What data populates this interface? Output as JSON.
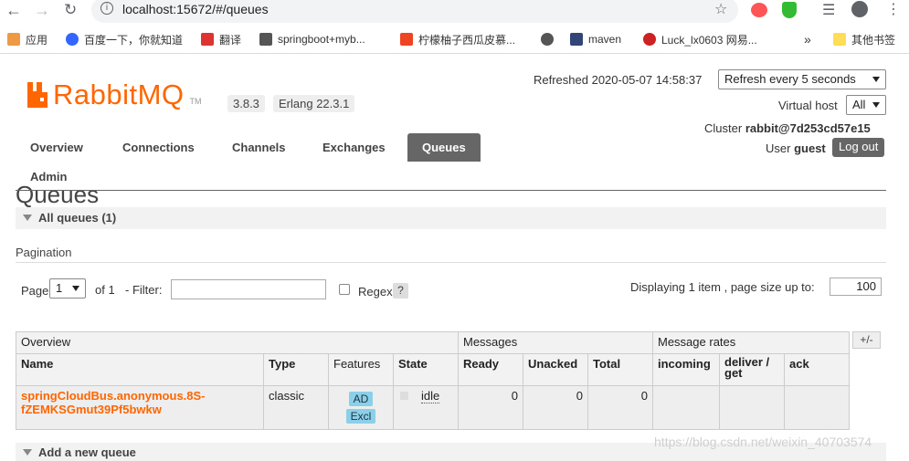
{
  "browser": {
    "url": "localhost:15672/#/queues",
    "bookmarks": [
      "应用",
      "百度一下，你就知道",
      "翻译",
      "springboot+myb...",
      "柠檬柚子西瓜皮慕...",
      "maven",
      "Luck_lx0603 网易...",
      "其他书签"
    ],
    "overflow": "»"
  },
  "header": {
    "brand": "RabbitMQ",
    "tm": "TM",
    "version": "3.8.3",
    "erlang": "Erlang 22.3.1",
    "refreshed_label": "Refreshed 2020-05-07 14:58:37",
    "refresh_select": "Refresh every 5 seconds",
    "vhost_label": "Virtual host",
    "vhost_select": "All",
    "cluster_label": "Cluster",
    "cluster_value": "rabbit@7d253cd57e15",
    "user_label": "User",
    "user_value": "guest",
    "logout": "Log out"
  },
  "tabs": [
    "Overview",
    "Connections",
    "Channels",
    "Exchanges",
    "Queues",
    "Admin"
  ],
  "page": {
    "title": "Queues",
    "all_queues": "All queues (1)",
    "pagination": "Pagination",
    "page_label": "Page",
    "page_select": "1",
    "of_label": "of 1",
    "filter_label": "- Filter:",
    "regex_label": "Regex",
    "help": "?",
    "displaying": "Displaying 1 item , page size up to:",
    "page_size": "100",
    "add_queue": "Add a new queue",
    "plusminus": "+/-"
  },
  "table": {
    "groups": [
      "Overview",
      "Messages",
      "Message rates"
    ],
    "columns": [
      "Name",
      "Type",
      "Features",
      "State",
      "Ready",
      "Unacked",
      "Total",
      "incoming",
      "deliver / get",
      "ack"
    ],
    "rows": [
      {
        "name_line1": "springCloudBus.anonymous.8S-",
        "name_line2": "fZEMKSGmut39Pf5bwkw",
        "type": "classic",
        "feature1": "AD",
        "feature2": "Excl",
        "state": "idle",
        "ready": "0",
        "unacked": "0",
        "total": "0",
        "incoming": "",
        "deliver_get": "",
        "ack": ""
      }
    ]
  },
  "watermark": "https://blog.csdn.net/weixin_40703574",
  "colors": {
    "accent": "#ff6600",
    "tab_active": "#666666"
  }
}
